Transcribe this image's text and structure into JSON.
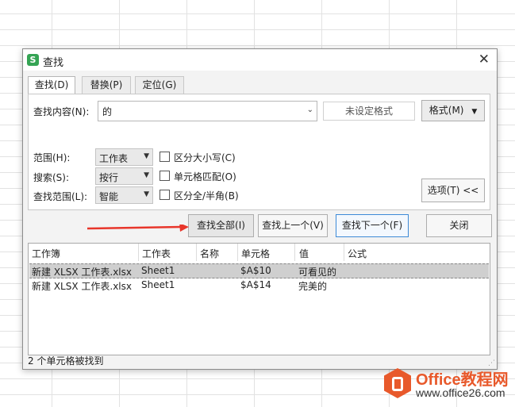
{
  "dialog": {
    "title": "查找",
    "tabs": [
      {
        "label": "查找(D)",
        "active": true
      },
      {
        "label": "替换(P)",
        "active": false
      },
      {
        "label": "定位(G)",
        "active": false
      }
    ],
    "find_label": "查找内容(N):",
    "find_value": "的",
    "format_status": "未设定格式",
    "format_button": "格式(M)",
    "scope_label": "范围(H):",
    "scope_value": "工作表",
    "search_label": "搜索(S):",
    "search_value": "按行",
    "lookin_label": "查找范围(L):",
    "lookin_value": "智能",
    "match_case": "区分大小写(C)",
    "match_cell": "单元格匹配(O)",
    "match_width": "区分全/半角(B)",
    "options_button": "选项(T) <<",
    "find_all_button": "查找全部(I)",
    "find_prev_button": "查找上一个(V)",
    "find_next_button": "查找下一个(F)",
    "close_button": "关闭",
    "results": {
      "columns": [
        "工作簿",
        "工作表",
        "名称",
        "单元格",
        "值",
        "公式"
      ],
      "rows": [
        {
          "book": "新建 XLSX 工作表.xlsx",
          "sheet": "Sheet1",
          "name": "",
          "cell": "$A$10",
          "value": "可看见的",
          "formula": ""
        },
        {
          "book": "新建 XLSX 工作表.xlsx",
          "sheet": "Sheet1",
          "name": "",
          "cell": "$A$14",
          "value": "完美的",
          "formula": ""
        }
      ]
    },
    "status": "2 个单元格被找到"
  },
  "watermark": {
    "brand": "Office教程网",
    "url": "www.office26.com"
  },
  "colors": {
    "annotation_arrow": "#e8362b",
    "brand": "#e8592b",
    "app_icon": "#35a454"
  }
}
